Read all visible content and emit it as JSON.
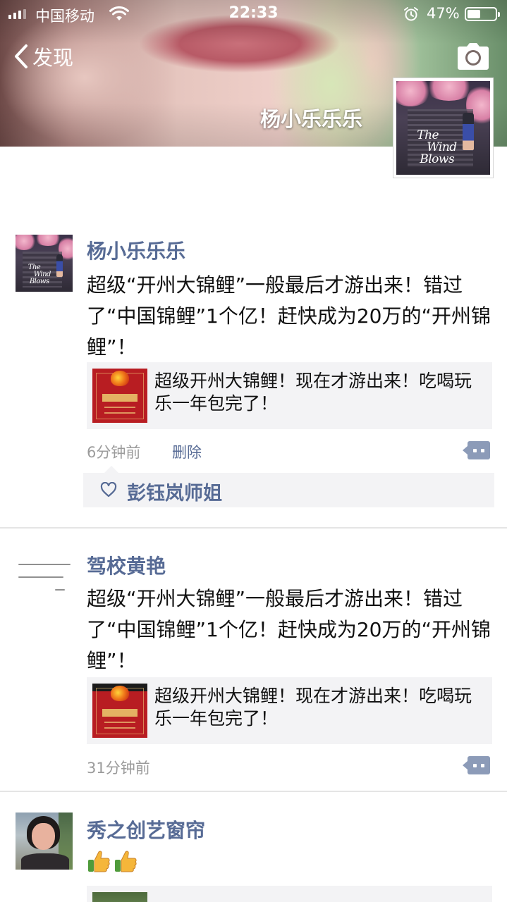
{
  "status_bar": {
    "carrier": "中国移动",
    "time": "22:33",
    "battery_percent": "47%",
    "battery_level": 0.47,
    "icons": [
      "signal-icon",
      "wifi-icon",
      "alarm-icon",
      "battery-icon"
    ]
  },
  "nav": {
    "back_label": "发现",
    "back_icon": "chevron-left-icon",
    "camera_icon": "camera-icon"
  },
  "profile": {
    "name": "杨小乐乐乐",
    "avatar_text_lines": [
      "The",
      "Wind",
      "Blows"
    ]
  },
  "colors": {
    "link_blue": "#576b95",
    "card_bg": "#f3f3f5",
    "time_gray": "#9b9b9b",
    "comment_button": "#8c9bb8"
  },
  "posts": [
    {
      "author": "杨小乐乐乐",
      "avatar": "book-cover",
      "text": "超级“开州大锦鲤”一般最后才游出来！错过了“中国锦鲤”1个亿！赶快成为20万的“开州锦鲤”！",
      "link_title": "超级开州大锦鲤！现在才游出来！吃喝玩乐一年包完了！",
      "time": "6分钟前",
      "delete_label": "删除",
      "likes": [
        "彭钰岚师姐"
      ]
    },
    {
      "author": "驾校黄艳",
      "avatar": "handwriting",
      "text": "超级“开州大锦鲤”一般最后才游出来！错过了“中国锦鲤”1个亿！赶快成为20万的“开州锦鲤”！",
      "link_title": "超级开州大锦鲤！现在才游出来！吃喝玩乐一年包完了！",
      "time": "31分钟前"
    },
    {
      "author": "秀之创艺窗帘",
      "avatar": "photo",
      "emoji": [
        "thumbs-up-icon",
        "thumbs-up-icon"
      ]
    }
  ]
}
